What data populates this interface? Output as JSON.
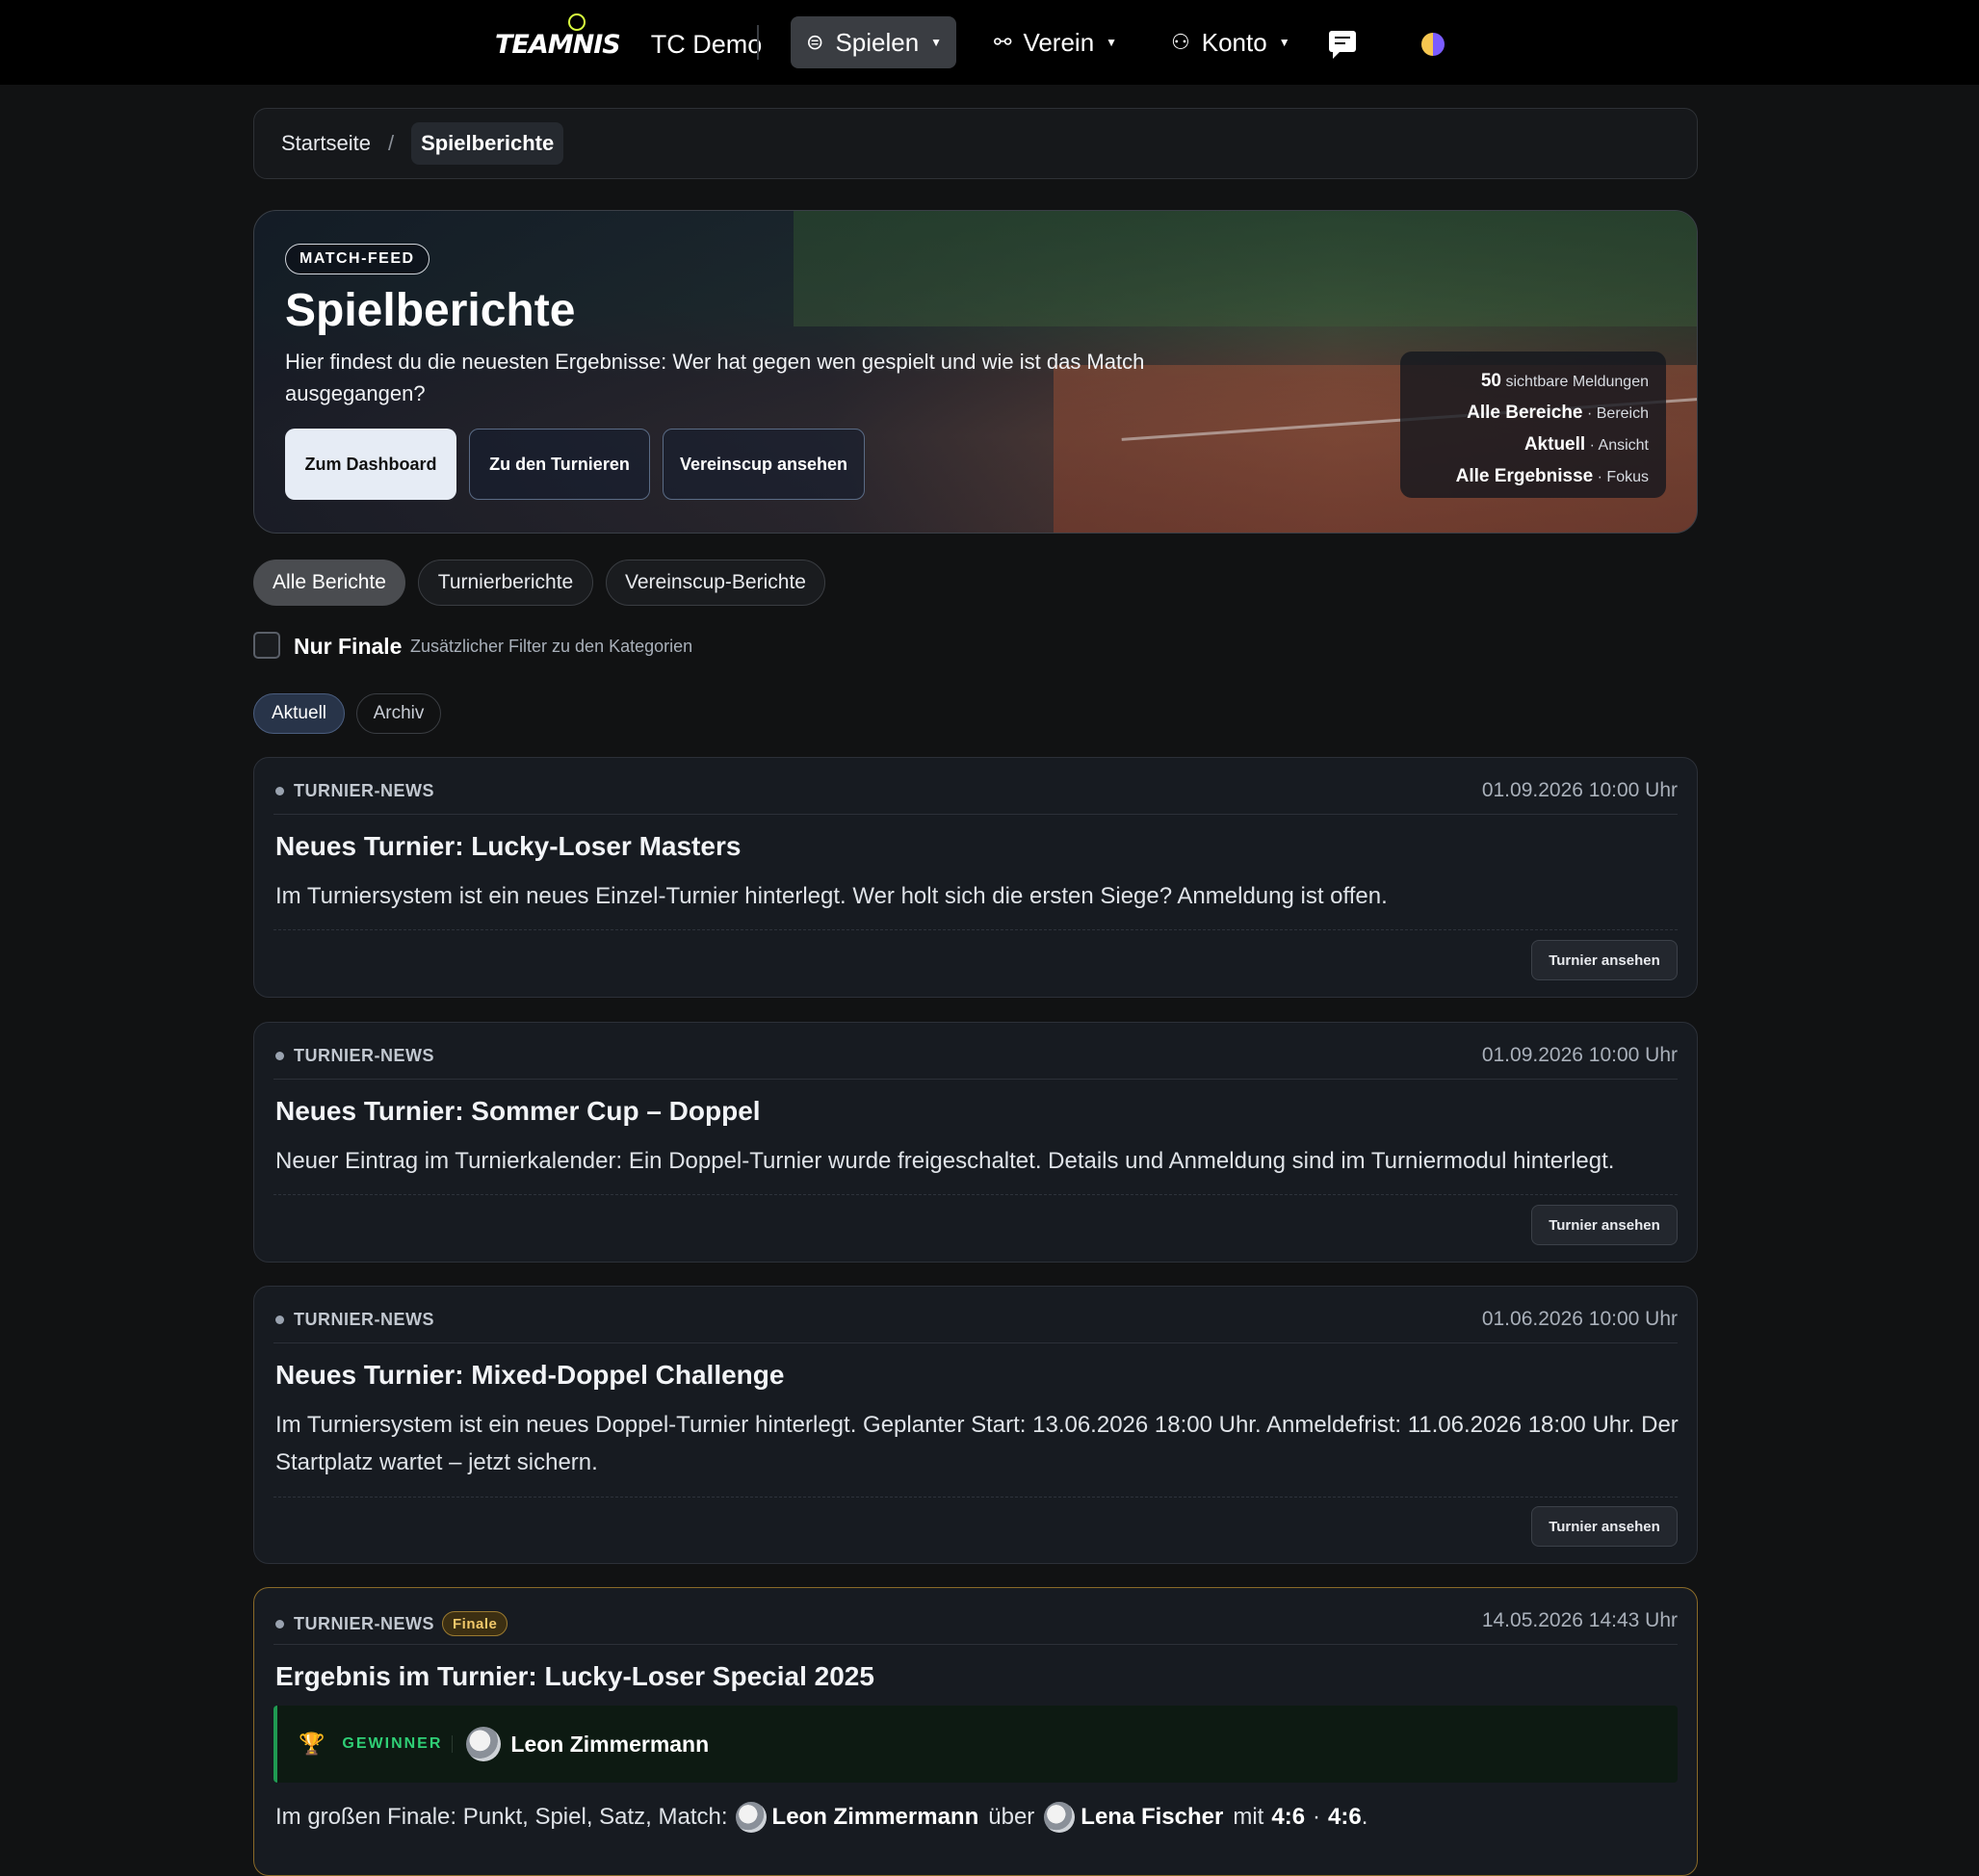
{
  "nav": {
    "logo": "TEAMNIS",
    "club": "TC Demo",
    "spielen": "Spielen",
    "verein": "Verein",
    "konto": "Konto"
  },
  "breadcrumb": {
    "home": "Startseite",
    "separator": "/",
    "current": "Spielberichte"
  },
  "hero": {
    "badge": "MATCH-FEED",
    "title": "Spielberichte",
    "text": "Hier findest du die neuesten Ergebnisse: Wer hat gegen wen gespielt und wie ist das Match ausgegangen?",
    "buttons": [
      "Zum Dashboard",
      "Zu den Turnieren",
      "Vereinscup ansehen"
    ],
    "stats": [
      {
        "value": "50",
        "label": "sichtbare Meldungen"
      },
      {
        "value": "Alle Bereiche",
        "label": "· Bereich"
      },
      {
        "value": "Aktuell",
        "label": "· Ansicht"
      },
      {
        "value": "Alle Ergebnisse",
        "label": "· Fokus"
      }
    ]
  },
  "filters": {
    "categories": [
      "Alle Berichte",
      "Turnierberichte",
      "Vereinscup-Berichte"
    ],
    "finale_label": "Nur Finale",
    "finale_hint": "Zusätzlicher Filter zu den Kategorien",
    "views": [
      "Aktuell",
      "Archiv"
    ]
  },
  "cards": [
    {
      "category": "TURNIER-NEWS",
      "date": "01.09.2026 10:00 Uhr",
      "title": "Neues Turnier: Lucky-Loser Masters",
      "text": "Im Turniersystem ist ein neues Einzel-Turnier hinterlegt. Wer holt sich die ersten Siege? Anmeldung ist offen.",
      "button": "Turnier ansehen"
    },
    {
      "category": "TURNIER-NEWS",
      "date": "01.09.2026 10:00 Uhr",
      "title": "Neues Turnier: Sommer Cup – Doppel",
      "text": "Neuer Eintrag im Turnierkalender: Ein Doppel-Turnier wurde freigeschaltet. Details und Anmeldung sind im Turniermodul hinterlegt.",
      "button": "Turnier ansehen"
    },
    {
      "category": "TURNIER-NEWS",
      "date": "01.06.2026 10:00 Uhr",
      "title": "Neues Turnier: Mixed-Doppel Challenge",
      "text": "Im Turniersystem ist ein neues Doppel-Turnier hinterlegt. Geplanter Start: 13.06.2026 18:00 Uhr. Anmeldefrist: 11.06.2026 18:00 Uhr. Der Startplatz wartet – jetzt sichern.",
      "button": "Turnier ansehen"
    },
    {
      "category": "TURNIER-NEWS",
      "tag": "Finale",
      "date": "14.05.2026 14:43 Uhr",
      "title": "Ergebnis im Turnier: Lucky-Loser Special 2025",
      "winner_label": "GEWINNER",
      "winner": "Leon Zimmermann",
      "final_prefix": "Im großen Finale: Punkt, Spiel, Satz, Match:",
      "player_a": "Leon Zimmermann",
      "over": "über",
      "player_b": "Lena Fischer",
      "with": "mit",
      "score_1": "4:6",
      "score_sep": "·",
      "score_2": "4:6",
      "period": "."
    }
  ],
  "colors": {
    "background": "#111213",
    "card": "#171b21",
    "accent_green": "#2fcf76",
    "finale_gold": "#f1c86a"
  }
}
